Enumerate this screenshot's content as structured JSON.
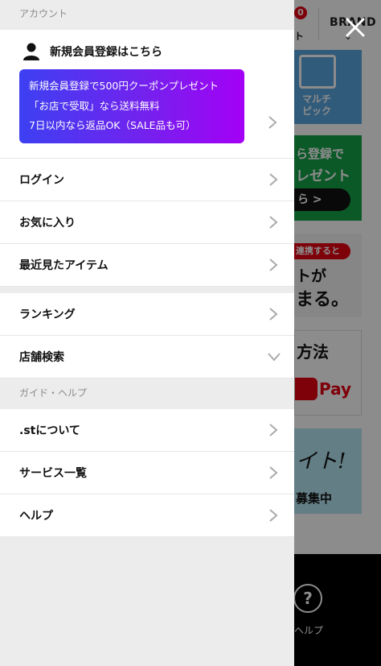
{
  "background": {
    "cart_badge": "0",
    "cart_label": "ト",
    "brand_label": "BRAND",
    "tile_multi_pick": [
      "マルチ",
      "ピック"
    ],
    "tile_green_line1": "ら登録で",
    "tile_green_line2": "レゼント",
    "tile_green_pill": "ら >",
    "tile_red_tag": "連携すると",
    "tile_red_line1": "トが",
    "tile_red_line2": "まる。",
    "tile_pay_line1": "方法",
    "tile_pay_label": "Pay",
    "tile_cyan_line1": "イト!",
    "tile_cyan_line2": "募集中",
    "footer_help_symbol": "?",
    "footer_help_label": "ヘルプ"
  },
  "drawer": {
    "account_header": "アカウント",
    "register_link": "新規会員登録はこちら",
    "promo_lines": [
      "新規会員登録で500円クーポンプレゼント",
      "「お店で受取」なら送料無料",
      "7日以内なら返品OK（SALE品も可）"
    ],
    "menu_group1": [
      {
        "label": "ログイン"
      },
      {
        "label": "お気に入り"
      },
      {
        "label": "最近見たアイテム"
      }
    ],
    "menu_group2": [
      {
        "label": "ランキング"
      },
      {
        "label": "店舗検索"
      }
    ],
    "guide_header": "ガイド・ヘルプ",
    "menu_group3": [
      {
        "label": ".stについて"
      },
      {
        "label": "サービス一覧"
      },
      {
        "label": "ヘルプ"
      }
    ]
  }
}
